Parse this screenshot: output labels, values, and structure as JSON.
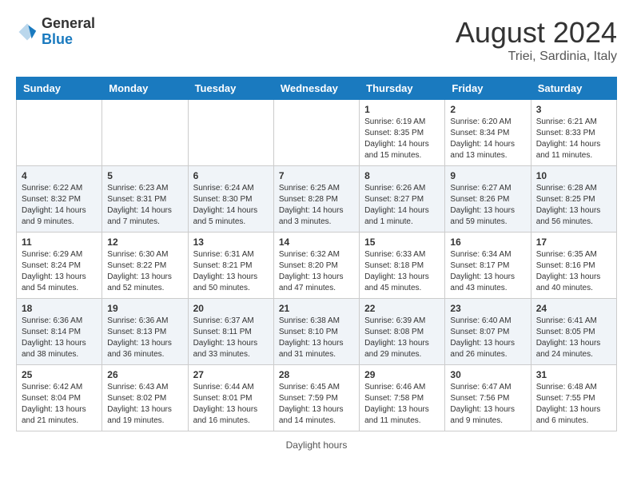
{
  "header": {
    "logo_general": "General",
    "logo_blue": "Blue",
    "month_year": "August 2024",
    "location": "Triei, Sardinia, Italy"
  },
  "days_of_week": [
    "Sunday",
    "Monday",
    "Tuesday",
    "Wednesday",
    "Thursday",
    "Friday",
    "Saturday"
  ],
  "weeks": [
    [
      {
        "day": "",
        "info": ""
      },
      {
        "day": "",
        "info": ""
      },
      {
        "day": "",
        "info": ""
      },
      {
        "day": "",
        "info": ""
      },
      {
        "day": "1",
        "info": "Sunrise: 6:19 AM\nSunset: 8:35 PM\nDaylight: 14 hours and 15 minutes."
      },
      {
        "day": "2",
        "info": "Sunrise: 6:20 AM\nSunset: 8:34 PM\nDaylight: 14 hours and 13 minutes."
      },
      {
        "day": "3",
        "info": "Sunrise: 6:21 AM\nSunset: 8:33 PM\nDaylight: 14 hours and 11 minutes."
      }
    ],
    [
      {
        "day": "4",
        "info": "Sunrise: 6:22 AM\nSunset: 8:32 PM\nDaylight: 14 hours and 9 minutes."
      },
      {
        "day": "5",
        "info": "Sunrise: 6:23 AM\nSunset: 8:31 PM\nDaylight: 14 hours and 7 minutes."
      },
      {
        "day": "6",
        "info": "Sunrise: 6:24 AM\nSunset: 8:30 PM\nDaylight: 14 hours and 5 minutes."
      },
      {
        "day": "7",
        "info": "Sunrise: 6:25 AM\nSunset: 8:28 PM\nDaylight: 14 hours and 3 minutes."
      },
      {
        "day": "8",
        "info": "Sunrise: 6:26 AM\nSunset: 8:27 PM\nDaylight: 14 hours and 1 minute."
      },
      {
        "day": "9",
        "info": "Sunrise: 6:27 AM\nSunset: 8:26 PM\nDaylight: 13 hours and 59 minutes."
      },
      {
        "day": "10",
        "info": "Sunrise: 6:28 AM\nSunset: 8:25 PM\nDaylight: 13 hours and 56 minutes."
      }
    ],
    [
      {
        "day": "11",
        "info": "Sunrise: 6:29 AM\nSunset: 8:24 PM\nDaylight: 13 hours and 54 minutes."
      },
      {
        "day": "12",
        "info": "Sunrise: 6:30 AM\nSunset: 8:22 PM\nDaylight: 13 hours and 52 minutes."
      },
      {
        "day": "13",
        "info": "Sunrise: 6:31 AM\nSunset: 8:21 PM\nDaylight: 13 hours and 50 minutes."
      },
      {
        "day": "14",
        "info": "Sunrise: 6:32 AM\nSunset: 8:20 PM\nDaylight: 13 hours and 47 minutes."
      },
      {
        "day": "15",
        "info": "Sunrise: 6:33 AM\nSunset: 8:18 PM\nDaylight: 13 hours and 45 minutes."
      },
      {
        "day": "16",
        "info": "Sunrise: 6:34 AM\nSunset: 8:17 PM\nDaylight: 13 hours and 43 minutes."
      },
      {
        "day": "17",
        "info": "Sunrise: 6:35 AM\nSunset: 8:16 PM\nDaylight: 13 hours and 40 minutes."
      }
    ],
    [
      {
        "day": "18",
        "info": "Sunrise: 6:36 AM\nSunset: 8:14 PM\nDaylight: 13 hours and 38 minutes."
      },
      {
        "day": "19",
        "info": "Sunrise: 6:36 AM\nSunset: 8:13 PM\nDaylight: 13 hours and 36 minutes."
      },
      {
        "day": "20",
        "info": "Sunrise: 6:37 AM\nSunset: 8:11 PM\nDaylight: 13 hours and 33 minutes."
      },
      {
        "day": "21",
        "info": "Sunrise: 6:38 AM\nSunset: 8:10 PM\nDaylight: 13 hours and 31 minutes."
      },
      {
        "day": "22",
        "info": "Sunrise: 6:39 AM\nSunset: 8:08 PM\nDaylight: 13 hours and 29 minutes."
      },
      {
        "day": "23",
        "info": "Sunrise: 6:40 AM\nSunset: 8:07 PM\nDaylight: 13 hours and 26 minutes."
      },
      {
        "day": "24",
        "info": "Sunrise: 6:41 AM\nSunset: 8:05 PM\nDaylight: 13 hours and 24 minutes."
      }
    ],
    [
      {
        "day": "25",
        "info": "Sunrise: 6:42 AM\nSunset: 8:04 PM\nDaylight: 13 hours and 21 minutes."
      },
      {
        "day": "26",
        "info": "Sunrise: 6:43 AM\nSunset: 8:02 PM\nDaylight: 13 hours and 19 minutes."
      },
      {
        "day": "27",
        "info": "Sunrise: 6:44 AM\nSunset: 8:01 PM\nDaylight: 13 hours and 16 minutes."
      },
      {
        "day": "28",
        "info": "Sunrise: 6:45 AM\nSunset: 7:59 PM\nDaylight: 13 hours and 14 minutes."
      },
      {
        "day": "29",
        "info": "Sunrise: 6:46 AM\nSunset: 7:58 PM\nDaylight: 13 hours and 11 minutes."
      },
      {
        "day": "30",
        "info": "Sunrise: 6:47 AM\nSunset: 7:56 PM\nDaylight: 13 hours and 9 minutes."
      },
      {
        "day": "31",
        "info": "Sunrise: 6:48 AM\nSunset: 7:55 PM\nDaylight: 13 hours and 6 minutes."
      }
    ]
  ],
  "footer": {
    "note": "Daylight hours"
  }
}
